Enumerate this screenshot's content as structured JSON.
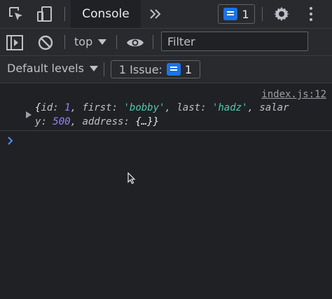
{
  "top_bar": {
    "active_tab": "Console",
    "more_tabs_icon": "double-chevron-right-icon",
    "issues_count": "1"
  },
  "toolbar": {
    "context": "top",
    "filter_placeholder": "Filter"
  },
  "levels_bar": {
    "levels_label": "Default levels",
    "issue_label": "1 Issue:",
    "issue_count": "1"
  },
  "console": {
    "source": "index.js:12",
    "entry": {
      "open": "{",
      "k_id": "id",
      "v_id": "1",
      "k_first": "first",
      "v_first": "'bobby'",
      "k_last": "last",
      "v_last": "'hadz'",
      "k_sal_a": "salar",
      "k_sal_b": "y",
      "v_sal": "500",
      "k_addr": "address",
      "v_addr": "{…}",
      "close": "}"
    }
  },
  "colors": {
    "accent": "#1a73e8",
    "background": "#202124",
    "toolbar": "#292a2d"
  }
}
